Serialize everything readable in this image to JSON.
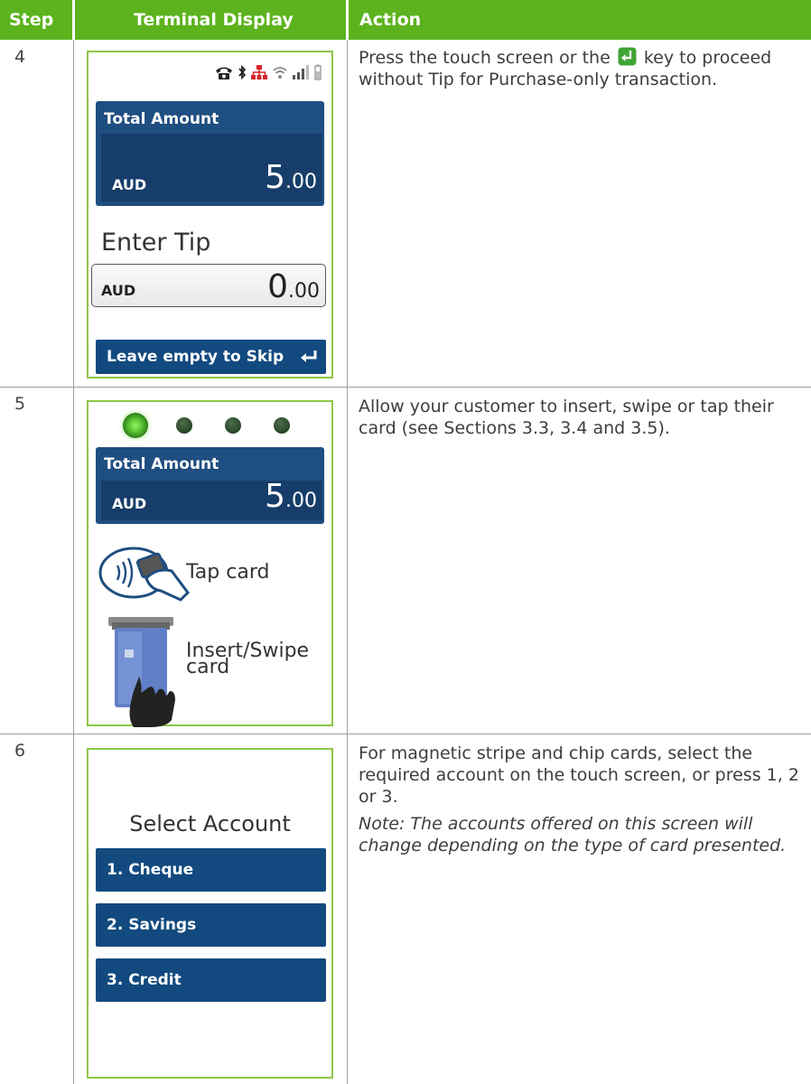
{
  "header": {
    "step": "Step",
    "terminal_display": "Terminal Display",
    "action": "Action"
  },
  "rows": [
    {
      "step": "4",
      "screen": {
        "status_icons": [
          "phone-icon",
          "bluetooth-icon",
          "network-icon",
          "wifi-icon",
          "signal-icon",
          "battery-icon"
        ],
        "total_label": "Total Amount",
        "currency": "AUD",
        "total_int": "5",
        "total_dec": ".00",
        "prompt": "Enter Tip",
        "tip_currency": "AUD",
        "tip_int": "0",
        "tip_dec": ".00",
        "skip_button": "Leave empty to Skip"
      },
      "action_before": "Press the touch screen or the",
      "action_after": "key to proceed without Tip for Purchase-only transaction."
    },
    {
      "step": "5",
      "screen": {
        "total_label": "Total Amount",
        "currency": "AUD",
        "total_int": "5",
        "total_dec": ".00",
        "tap_label": "Tap card",
        "insert_label_1": "Insert/Swipe",
        "insert_label_2": "card"
      },
      "action": "Allow your customer to insert, swipe or tap their card (see Sections 3.3, 3.4 and 3.5)."
    },
    {
      "step": "6",
      "screen": {
        "title": "Select Account",
        "options": [
          "1. Cheque",
          "2. Savings",
          "3. Credit"
        ]
      },
      "action": "For magnetic stripe and chip cards, select the required account on the touch screen, or press 1, 2 or 3.",
      "note": "Note: The accounts offered on this screen will change depending on the type of card presented."
    }
  ],
  "colors": {
    "header_green": "#5cb31d",
    "frame_green": "#8ec548",
    "panel_blue": "#1f4e80",
    "button_blue": "#124a7f"
  }
}
